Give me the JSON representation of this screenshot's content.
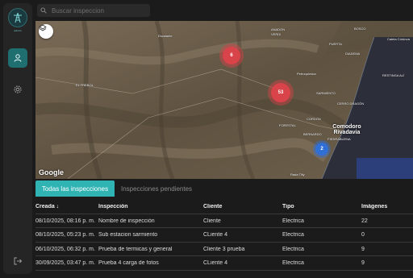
{
  "app": {
    "logo_caption": "admin"
  },
  "search": {
    "placeholder": "Buscar inspeccion"
  },
  "map": {
    "clusters": [
      {
        "count": "6",
        "color": "#d9434a"
      },
      {
        "count": "53",
        "color": "#d9434a"
      },
      {
        "count": "2",
        "color": "#2f6fd6"
      }
    ],
    "city": {
      "line1": "Comodoro",
      "line2": "Rivadavia"
    },
    "labels": [
      "Escalante",
      "ANADON",
      "VERDI",
      "BOSCO",
      "PUERTA",
      "DIADEMA",
      "EL TRÉBOL",
      "Petroquímica",
      "SARMIENTO",
      "CERRO DRAGÓN",
      "CORDÓN",
      "FORESTAL",
      "PIEDRABUENA",
      "BERNARDO",
      "Rada Tilly",
      "RESTINGA ALÍ",
      "Caleta Córdova"
    ],
    "attribution": "Google",
    "water_color": "#2c3f7a"
  },
  "tabs": {
    "all": "Todas las inspecciones",
    "pending": "Inspecciones pendientes"
  },
  "table": {
    "headers": [
      "Creada ↓",
      "Inspección",
      "Cliente",
      "Tipo",
      "Imágenes"
    ],
    "rows": [
      [
        "08/10/2025, 08:16 p. m.",
        "Nombre de inspección",
        "Cliente",
        "Electrica",
        "22"
      ],
      [
        "08/10/2025, 05:23 p. m.",
        "Sub estacion sarmiento",
        "CLiente 4",
        "Electrica",
        "0"
      ],
      [
        "06/10/2025, 06:32 p. m.",
        "Prueba de termicas y general",
        "Cliente 3 prueba",
        "Electrica",
        "9"
      ],
      [
        "30/09/2025, 03:47 p. m.",
        "Prueba 4 carga de fotos",
        "CLiente 4",
        "Electrica",
        "9"
      ]
    ]
  },
  "colors": {
    "accent": "#2fb3b3",
    "sidebar_active": "#1f6e70"
  }
}
